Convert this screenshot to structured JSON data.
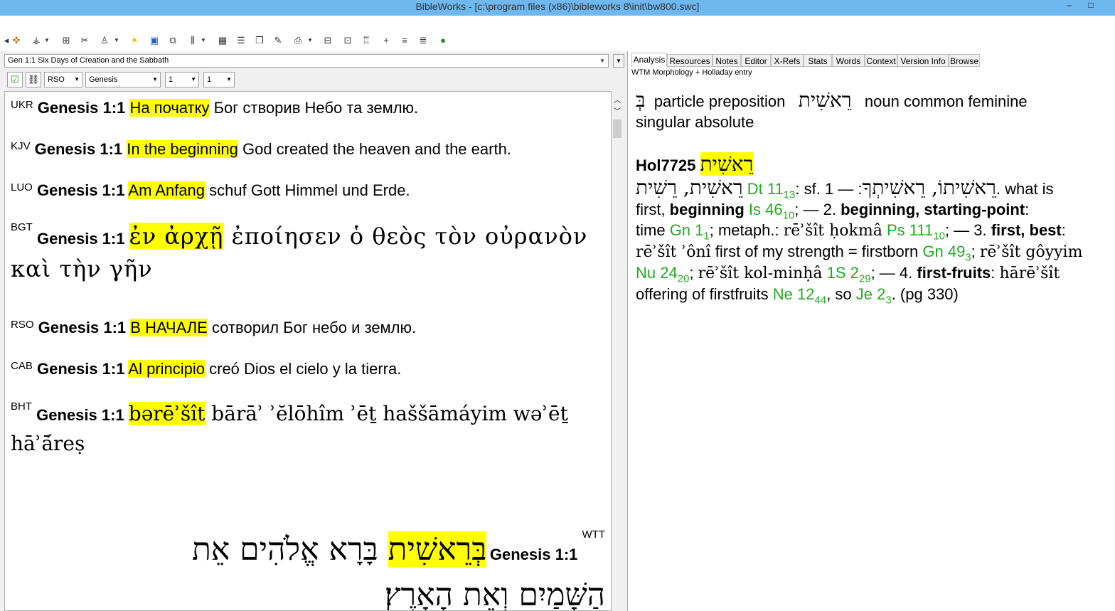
{
  "window": {
    "title": "BibleWorks - [c:\\program files (x86)\\bibleworks 8\\init\\bw800.swc]",
    "minimize_glyph": "–",
    "maximize_glyph": "□"
  },
  "toolbar": {
    "icons": [
      "crosshair-icon",
      "search-tool-icon",
      "bookmark-icon",
      "tools-icon",
      "person-icon",
      "lamp-icon",
      "window-icon",
      "windows-icon",
      "columns-icon",
      "grid-icon",
      "list-icon",
      "copy-icon",
      "edit-icon",
      "print-icon",
      "compare-icon",
      "layout-icon",
      "book-icon",
      "stamp-icon",
      "plus-icon",
      "ev-icon",
      "ew-icon",
      "globe-icon"
    ]
  },
  "left": {
    "verse_combo": "Gen 1:1 Six Days of Creation and the Sabbath",
    "version_select": "RSO",
    "book_select": "Genesis",
    "chapter_select": "1",
    "verse_select": "1",
    "verses": [
      {
        "ver": "UKR",
        "ref": "Genesis 1:1",
        "hl": "На початку",
        "rest": " Бог створив Небо та землю."
      },
      {
        "ver": "KJV",
        "ref": "Genesis 1:1",
        "hl": "In the beginning",
        "rest": " God created the heaven and the earth."
      },
      {
        "ver": "LUO",
        "ref": "Genesis 1:1",
        "hl": "Am Anfang",
        "rest": " schuf Gott Himmel und Erde."
      },
      {
        "ver": "BGT",
        "ref": "Genesis 1:1",
        "hl": "ἐν ἀρχῇ",
        "rest": " ἐποίησεν ὁ θεὸς τὸν οὐρανὸν",
        "line2": "καὶ τὴν γῆν"
      },
      {
        "ver": "RSO",
        "ref": "Genesis 1:1",
        "hl": "В НАЧАЛЕ",
        "rest": " сотворил Бог небо и землю."
      },
      {
        "ver": "CAB",
        "ref": "Genesis 1:1",
        "hl": "Al principio",
        "rest": " creó Dios el cielo y la tierra."
      },
      {
        "ver": "BHT",
        "ref": "Genesis 1:1",
        "hl": "bərēʾšît",
        "rest": " bārāʾ ʾĕlōhîm ʾēṯ haššāmáyim wəʾēṯ",
        "line2": "hāʾā́reṣ"
      },
      {
        "ver": "WTT",
        "ref": "Genesis 1:1",
        "hl": "בְּרֵאשִׁית",
        "rest": " בָּרָא אֱלֹהִים אֵת",
        "line2": "הַשָּׁמַיִם וְאֵת הָאָרֶץ׃"
      }
    ]
  },
  "right": {
    "tabs": [
      "Analysis",
      "Resources",
      "Notes",
      "Editor",
      "X-Refs",
      "Stats",
      "Words",
      "Context",
      "Version Info",
      "Browse"
    ],
    "subtitle": "WTM Morphology + Holladay entry",
    "morph": {
      "prefix": "בְּ",
      "prefix_desc": "particle preposition",
      "word": "רֵאשִׁית",
      "word_desc": "noun common feminine",
      "word_desc2": "singular absolute"
    },
    "entry": {
      "code": "Hol7725",
      "headword": "רֵאשִׁית",
      "forms": "רֵאשִׁית, רֵשִׁית",
      "ref1": "Dt 11",
      "ref1_sub": "13",
      "sf_label": ": sf. ",
      "sf_forms": "רֵאשִׁיתוֹ, רֵאשִׁיתְךָ",
      "after_sf": ": — 1. what is",
      "line2_a": "first, ",
      "beginning_bold": "beginning",
      "ref2": "Is 46",
      "ref2_sub": "10",
      "line2_b": "; — 2. ",
      "beginning2_bold": "beginning, starting-point",
      "line2_c": ":",
      "line3_a": "time ",
      "ref3": "Gn 1",
      "ref3_sub": "1",
      "line3_b": "; metaph.: ",
      "translit1": "rēʾšît ḥokmâ",
      "ref4": "Ps 111",
      "ref4_sub": "10",
      "line3_c": "; — 3. ",
      "first_best_bold": "first, best",
      "line3_d": ":",
      "translit2": "rēʾšît ʾônî",
      "line4_a": " first of my strength = firstborn ",
      "ref5": "Gn 49",
      "ref5_sub": "3",
      "line4_b": "; ",
      "translit3": "rēʾšît gôyyim",
      "ref6": "Nu 24",
      "ref6_sub": "20",
      "line5_a": "; ",
      "translit4": "rēʾšît kol-minḥâ",
      "ref7": "1S 2",
      "ref7_sub": "29",
      "line5_b": "; — 4. ",
      "firstfruits_bold": "first-fruits",
      "line5_c": ": ",
      "translit5": "hārēʾšît",
      "line6_a": "offering of firstfruits ",
      "ref8": "Ne 12",
      "ref8_sub": "44",
      "line6_b": ", so ",
      "ref9": "Je 2",
      "ref9_sub": "3",
      "line6_c": ". (pg 330)"
    }
  },
  "colors": {
    "highlight": "#ffff00",
    "ref_green": "#22aa22",
    "titlebar": "#6eb7ef"
  }
}
